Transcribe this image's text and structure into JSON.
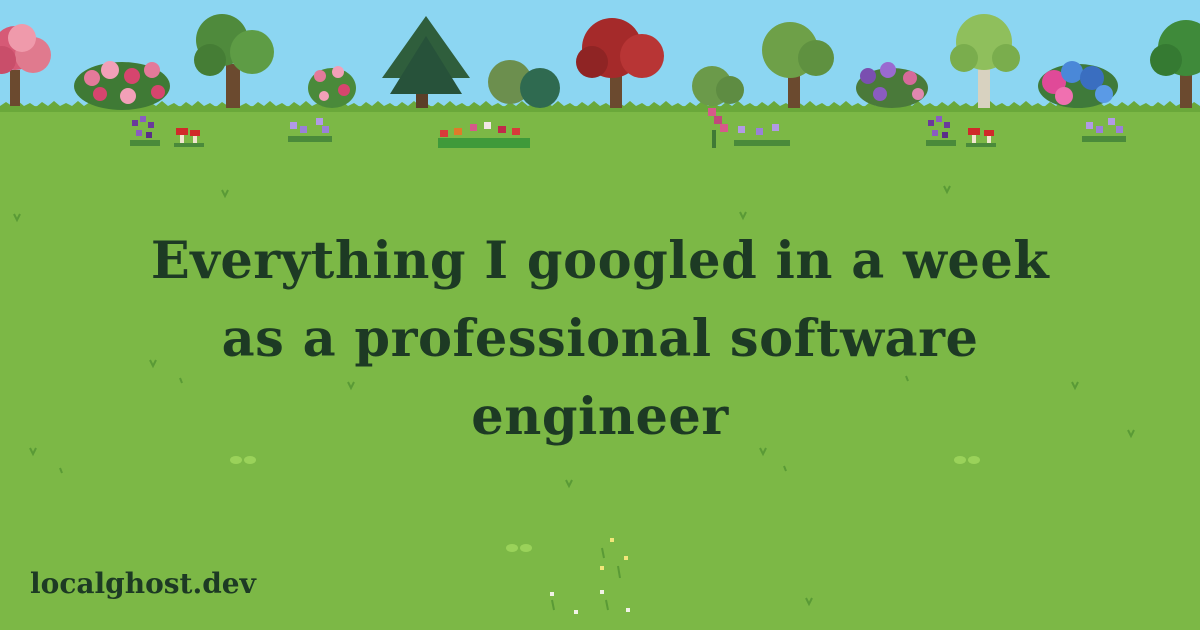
{
  "title": "Everything I googled in a week as a professional software engineer",
  "site": "localghost.dev",
  "colors": {
    "sky": "#8cd6f2",
    "grass": "#7cb846",
    "text": "#1d3a24"
  },
  "scenery": {
    "trees": [
      "pink-blossom-tree",
      "pink-rose-bush",
      "green-tree",
      "pink-flower-bush",
      "dark-pine-tree",
      "round-bush",
      "red-maple-tree",
      "small-green-bush",
      "green-tree",
      "purple-flower-bush",
      "birch-tree",
      "pink-blue-hydrangea-bush",
      "green-tree"
    ],
    "flowers": [
      "purple-flowers",
      "red-mushrooms",
      "lavender-flowers",
      "tulip-patch",
      "pink-foxglove",
      "lavender-flowers",
      "purple-flowers",
      "red-mushrooms",
      "lavender-flowers"
    ]
  }
}
